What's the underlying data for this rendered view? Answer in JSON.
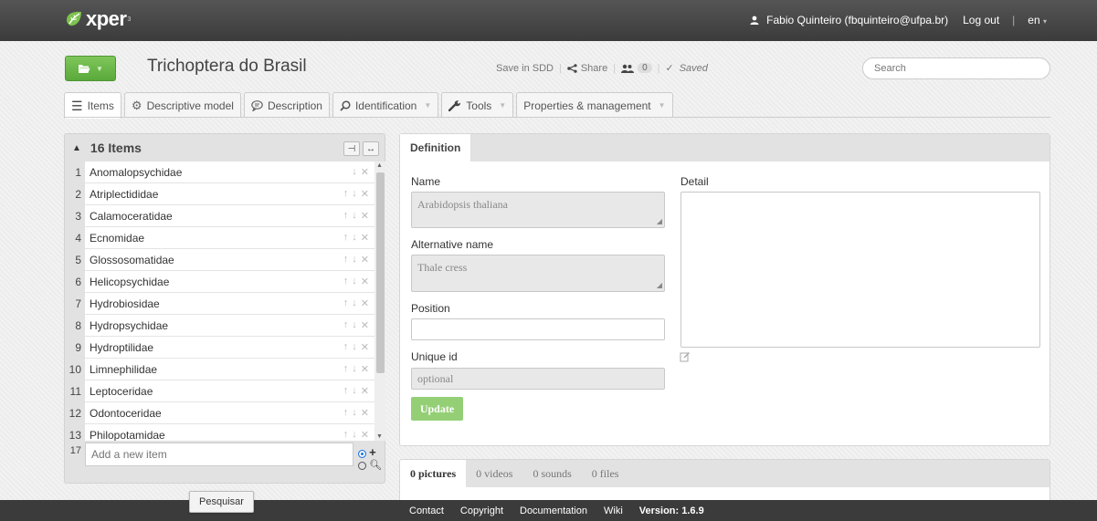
{
  "app": {
    "logo_text": "xper",
    "logo_sup": "3",
    "user": "Fabio Quinteiro (fbquinteiro@ufpa.br)",
    "logout": "Log out",
    "language": "en"
  },
  "header": {
    "project_title": "Trichoptera do Brasil",
    "save_sdd": "Save in SDD",
    "share": "Share",
    "users_count": "0",
    "saved": "Saved",
    "search_placeholder": "Search"
  },
  "tabs": [
    {
      "label": "Items"
    },
    {
      "label": "Descriptive model"
    },
    {
      "label": "Description"
    },
    {
      "label": "Identification"
    },
    {
      "label": "Tools"
    },
    {
      "label": "Properties & management"
    }
  ],
  "items_panel": {
    "count_label": "16 Items",
    "items": [
      {
        "num": "1",
        "label": "Anomalopsychidae"
      },
      {
        "num": "2",
        "label": "Atriplectididae"
      },
      {
        "num": "3",
        "label": "Calamoceratidae"
      },
      {
        "num": "4",
        "label": "Ecnomidae"
      },
      {
        "num": "5",
        "label": "Glossosomatidae"
      },
      {
        "num": "6",
        "label": "Helicopsychidae"
      },
      {
        "num": "7",
        "label": "Hydrobiosidae"
      },
      {
        "num": "8",
        "label": "Hydropsychidae"
      },
      {
        "num": "9",
        "label": "Hydroptilidae"
      },
      {
        "num": "10",
        "label": "Limnephilidae"
      },
      {
        "num": "11",
        "label": "Leptoceridae"
      },
      {
        "num": "12",
        "label": "Odontoceridae"
      },
      {
        "num": "13",
        "label": "Philopotamidae"
      }
    ],
    "new_num": "17",
    "new_placeholder": "Add a new item"
  },
  "definition": {
    "tab_label": "Definition",
    "name_label": "Name",
    "name_value": "Arabidopsis thaliana",
    "alt_label": "Alternative name",
    "alt_value": "Thale cress",
    "position_label": "Position",
    "position_value": "",
    "uid_label": "Unique id",
    "uid_placeholder": "optional",
    "detail_label": "Detail",
    "update_label": "Update"
  },
  "media": {
    "tabs": [
      "0 pictures",
      "0 videos",
      "0 sounds",
      "0 files"
    ]
  },
  "tooltip": "Pesquisar",
  "footer": {
    "links": [
      "Contact",
      "Copyright",
      "Documentation",
      "Wiki"
    ],
    "version": "Version: 1.6.9"
  },
  "colors": {
    "accent_green": "#6ab84a",
    "navbar": "#3b3b3b"
  }
}
